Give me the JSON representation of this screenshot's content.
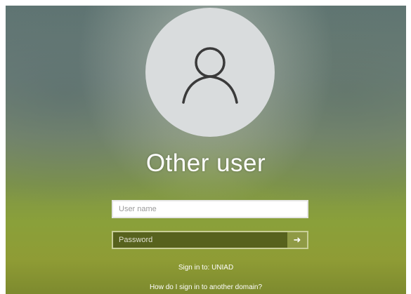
{
  "user": {
    "name": "Other user",
    "avatar_icon": "person-outline-icon"
  },
  "form": {
    "username_placeholder": "User name",
    "password_placeholder": "Password",
    "submit_icon": "arrow-right-icon"
  },
  "footer": {
    "sign_in_to": "Sign in to: UNIAD",
    "domain_link": "How do I sign in to another domain?"
  },
  "colors": {
    "avatar_bg": "#d9dcdd",
    "password_bg": "#464e16",
    "submit_bg": "#8f9a45"
  }
}
